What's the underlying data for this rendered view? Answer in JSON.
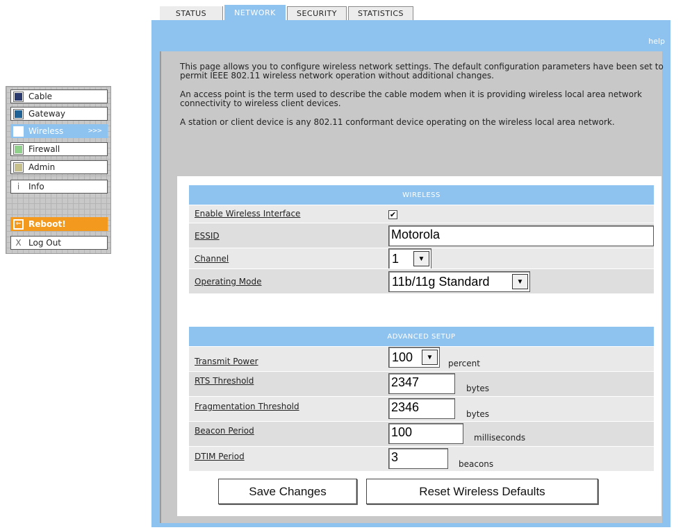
{
  "tabs": [
    {
      "label": "STATUS"
    },
    {
      "label": "NETWORK",
      "active": true
    },
    {
      "label": "SECURITY"
    },
    {
      "label": "STATISTICS"
    }
  ],
  "help_label": "help",
  "nav": {
    "items": [
      {
        "label": "Cable",
        "color": "#2b3a6e"
      },
      {
        "label": "Gateway",
        "color": "#1e6296"
      },
      {
        "label": "Wireless",
        "arrow": ">>>",
        "active": true
      },
      {
        "label": "Firewall",
        "color": "#8fd08a"
      },
      {
        "label": "Admin",
        "color": "#c8c08a"
      },
      {
        "label": "Info",
        "glyph": "i"
      },
      {
        "label": "Reboot!",
        "glyph": "⇐"
      },
      {
        "label": "Log Out",
        "glyph": "X"
      }
    ]
  },
  "intro": {
    "p1": "This page allows you to configure wireless network settings. The default configuration parameters have been set to permit IEEE 802.11 wireless network operation without additional changes.",
    "p2": "An access point is the term used to describe the cable modem when it is providing wireless local area network connectivity to wireless client devices.",
    "p3": "A station or client device is any 802.11 conformant device operating on the wireless local area network."
  },
  "wireless": {
    "heading": "WIRELESS",
    "enable_label": "Enable Wireless Interface",
    "enable_checked": true,
    "essid_label": "ESSID",
    "essid_value": "Motorola",
    "channel_label": "Channel",
    "channel_value": "1",
    "mode_label": "Operating Mode",
    "mode_value": "11b/11g Standard"
  },
  "advanced": {
    "heading": "ADVANCED SETUP",
    "tx_label": "Transmit Power",
    "tx_value": "100",
    "tx_unit": "percent",
    "rts_label": "RTS Threshold",
    "rts_value": "2347",
    "rts_unit": "bytes",
    "frag_label": "Fragmentation Threshold",
    "frag_value": "2346",
    "frag_unit": "bytes",
    "beacon_label": "Beacon Period",
    "beacon_value": "100",
    "beacon_unit": "milliseconds",
    "dtim_label": "DTIM Period",
    "dtim_value": "3",
    "dtim_unit": "beacons"
  },
  "buttons": {
    "save": "Save Changes",
    "reset": "Reset Wireless Defaults"
  },
  "colors": {
    "accent": "#8fc3ef",
    "reboot": "#f39a1e",
    "panel": "#c8c8c8"
  }
}
